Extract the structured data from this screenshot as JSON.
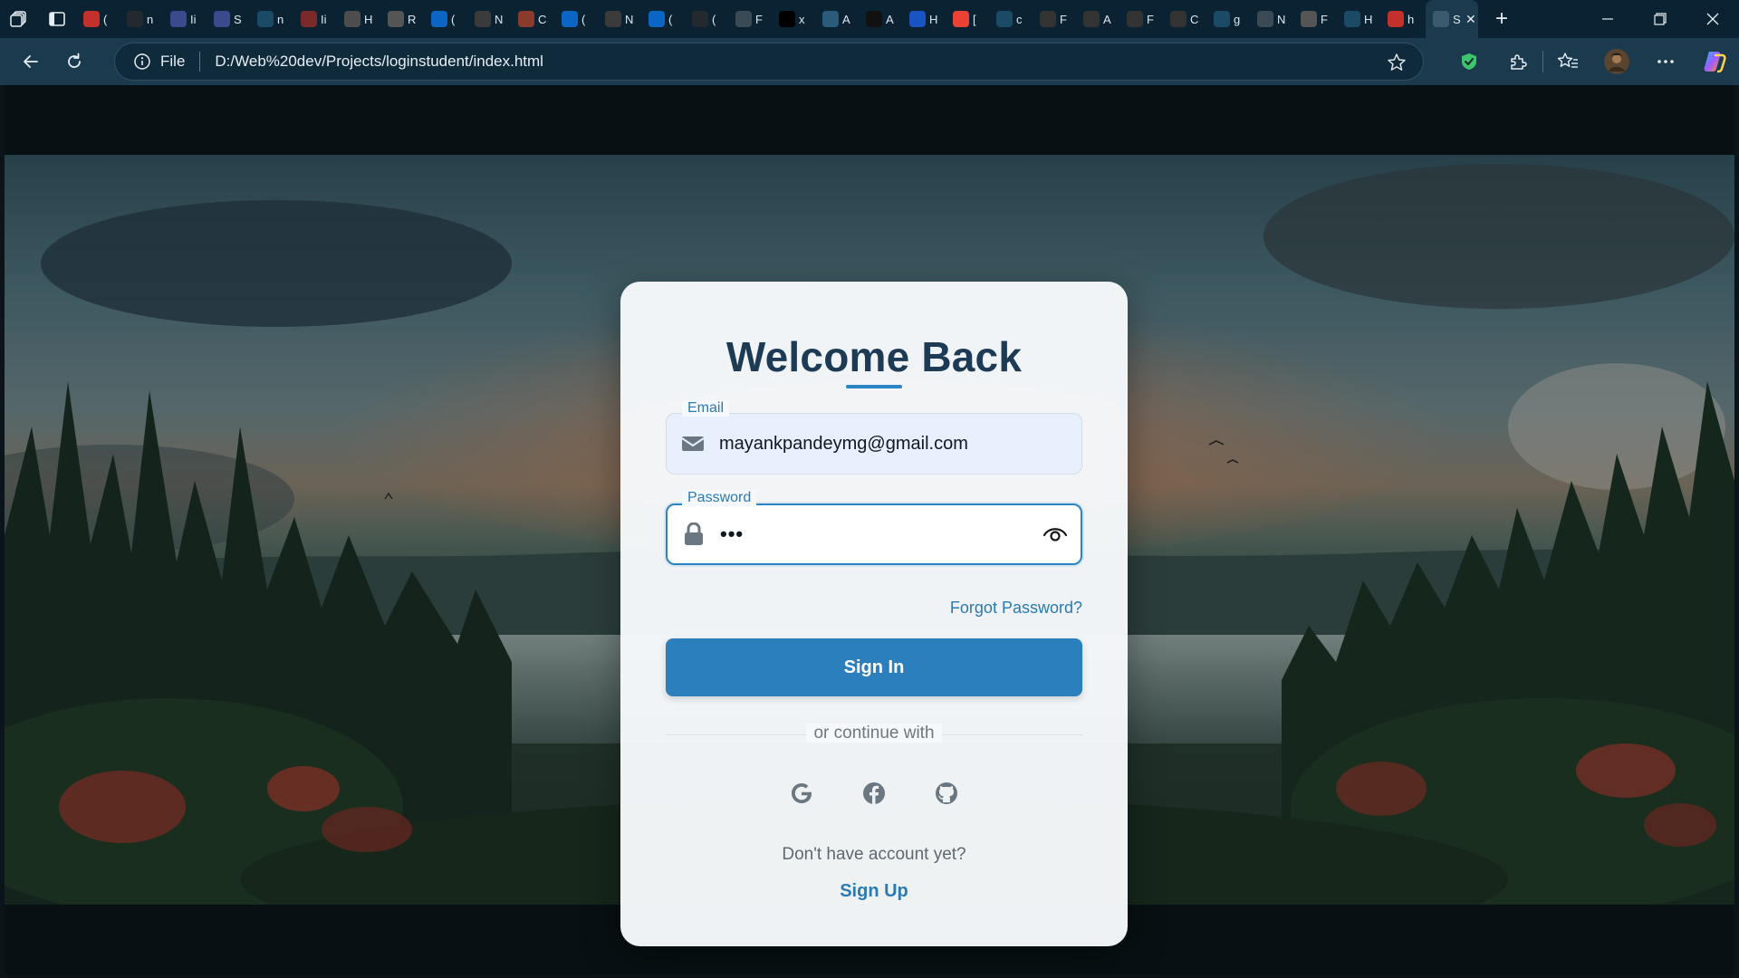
{
  "browser": {
    "tabs": [
      {
        "label": "(",
        "icon": "youtube-icon",
        "color": "#c4302b"
      },
      {
        "label": "n",
        "icon": "github-icon",
        "color": "#24292e"
      },
      {
        "label": "Ii",
        "icon": "react-icon",
        "color": "#3a4a8c"
      },
      {
        "label": "S",
        "icon": "react-icon",
        "color": "#3a4a8c"
      },
      {
        "label": "n",
        "icon": "search-icon",
        "color": "#1a4a66"
      },
      {
        "label": "Ii",
        "icon": "pen-icon",
        "color": "#7a2a2a"
      },
      {
        "label": "H",
        "icon": "w3-icon",
        "color": "#4d4d4d"
      },
      {
        "label": "R",
        "icon": "spiral-icon",
        "color": "#555555"
      },
      {
        "label": "(",
        "icon": "linkedin-icon",
        "color": "#0a66c2"
      },
      {
        "label": "N",
        "icon": "thumbnail-icon",
        "color": "#3b3b3b"
      },
      {
        "label": "C",
        "icon": "circle-icon",
        "color": "#8a3b2b"
      },
      {
        "label": "(",
        "icon": "linkedin-icon",
        "color": "#0a66c2"
      },
      {
        "label": "N",
        "icon": "thumbnail-icon",
        "color": "#3b3b3b"
      },
      {
        "label": "(",
        "icon": "linkedin-icon",
        "color": "#0a66c2"
      },
      {
        "label": "(",
        "icon": "github-icon",
        "color": "#24292e"
      },
      {
        "label": "F",
        "icon": "globe-icon",
        "color": "#3b4b55"
      },
      {
        "label": "x",
        "icon": "x-icon",
        "color": "#000000"
      },
      {
        "label": "A",
        "icon": "image-icon",
        "color": "#2b5b7b"
      },
      {
        "label": "A",
        "icon": "dev-icon",
        "color": "#111111"
      },
      {
        "label": "H",
        "icon": "blue-circle-icon",
        "color": "#1a53c2"
      },
      {
        "label": "[",
        "icon": "gmail-icon",
        "color": "#ea4335"
      },
      {
        "label": "c",
        "icon": "search-icon",
        "color": "#1a4a66"
      },
      {
        "label": "F",
        "icon": "cube-icon",
        "color": "#333333"
      },
      {
        "label": "A",
        "icon": "cube-icon",
        "color": "#333333"
      },
      {
        "label": "F",
        "icon": "cube-icon",
        "color": "#333333"
      },
      {
        "label": "C",
        "icon": "cube-icon",
        "color": "#333333"
      },
      {
        "label": "g",
        "icon": "search-icon",
        "color": "#1a4a66"
      },
      {
        "label": "N",
        "icon": "window-icon",
        "color": "#3b4b55"
      },
      {
        "label": "F",
        "icon": "spiral-icon",
        "color": "#555555"
      },
      {
        "label": "H",
        "icon": "search-icon",
        "color": "#1a4a66"
      },
      {
        "label": "h",
        "icon": "youtube-icon",
        "color": "#c4302b"
      }
    ],
    "active_tab": {
      "label": "S",
      "icon": "page-icon"
    },
    "address": {
      "scheme_label": "File",
      "url": "D:/Web%20dev/Projects/loginstudent/index.html"
    }
  },
  "login": {
    "title": "Welcome Back",
    "email": {
      "label": "Email",
      "value": "mayankpandeymg@gmail.com"
    },
    "password": {
      "label": "Password",
      "value": "•••"
    },
    "forgot": "Forgot Password?",
    "signin": "Sign In",
    "divider": "or continue with",
    "socials": [
      "google-icon",
      "facebook-icon",
      "github-icon"
    ],
    "no_account": "Don't have account yet?",
    "signup": "Sign Up"
  },
  "colors": {
    "accent": "#2b7fbc",
    "link": "#2a7ab3",
    "title": "#1d3b55",
    "browser_bg": "#0b2233",
    "toolbar_bg": "#1c3a4e"
  }
}
